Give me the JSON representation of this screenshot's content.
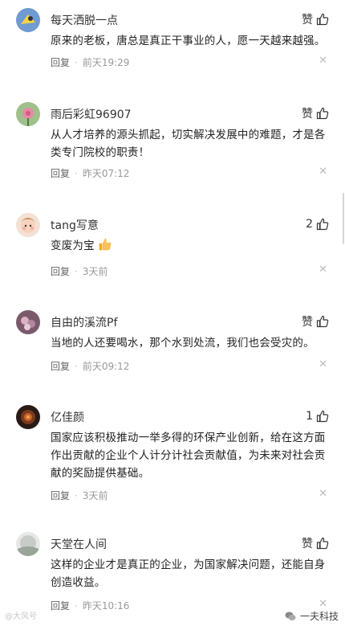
{
  "reply_label": "回复",
  "comments": [
    {
      "username": "每天洒脱一点",
      "like": "赞",
      "content": "原来的老板，唐总是真正干事业的人，愿一天越来越强。",
      "time": "前天19:29"
    },
    {
      "username": "雨后彩虹96907",
      "like": "赞",
      "content": "从人才培养的源头抓起，切实解决发展中的难题，才是各类专门院校的职责！",
      "time": "昨天07:12"
    },
    {
      "username": "tang写意",
      "like": "2",
      "content": "变废为宝",
      "time": "3天前"
    },
    {
      "username": "自由的溪流Pf",
      "like": "赞",
      "content": "当地的人还要喝水，那个水到处流，我们也会受灾的。",
      "time": "前天09:12"
    },
    {
      "username": "亿佳颜",
      "like": "1",
      "content": "国家应该积极推动一举多得的环保产业创新，给在这方面作出贡献的企业个人计分计社会贡献值，为未来对社会贡献的奖励提供基础。",
      "time": "3天前"
    },
    {
      "username": "天堂在人间",
      "like": "赞",
      "content": "这样的企业才是真正的企业，为国家解决问题，还能自身创造收益。",
      "time": "昨天10:16"
    }
  ],
  "footer": {
    "watermark": "@大风号",
    "account": "一夫科技"
  }
}
